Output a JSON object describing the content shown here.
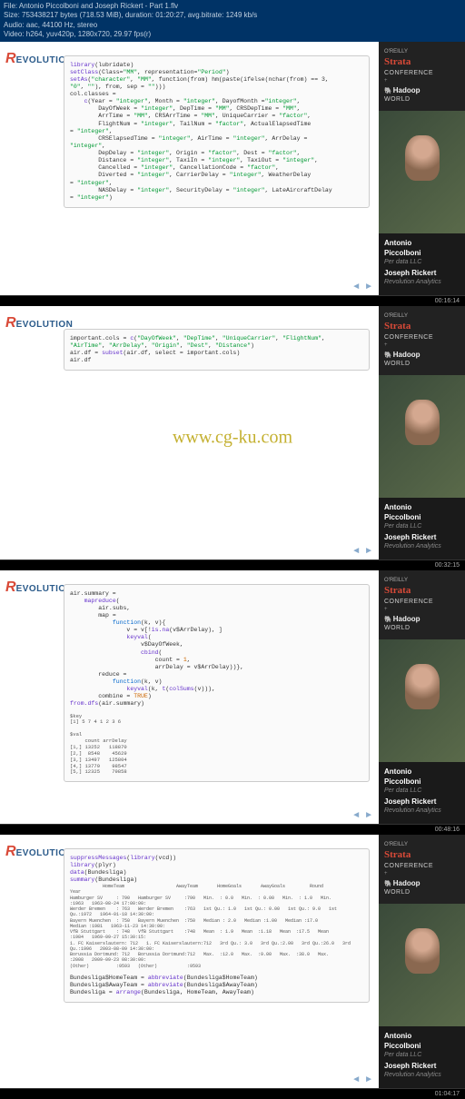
{
  "header": {
    "file": "File: Antonio Piccolboni and Joseph Rickert - Part 1.flv",
    "size": "Size: 753438217 bytes (718.53 MiB), duration: 01:20:27, avg.bitrate: 1249 kb/s",
    "audio": "Audio: aac, 44100 Hz, stereo",
    "video": "Video: h264, yuv420p, 1280x720, 29.97 fps(r)"
  },
  "watermark": "www.cg-ku.com",
  "conference": {
    "oreilly": "O'REILLY",
    "strata": "Strata",
    "conference": "CONFERENCE",
    "plus": "+",
    "hadoop": "Hadoop",
    "world": "WORLD"
  },
  "speakers": {
    "name1": "Antonio",
    "surname1": "Piccolboni",
    "org1": "Per data LLC",
    "name2": "Joseph Rickert",
    "org2": "Revolution Analytics"
  },
  "logo": {
    "r": "R",
    "rest": "EVOLUTION"
  },
  "nav": {
    "prev": "◄",
    "next": "►"
  },
  "timecodes": {
    "t1": "00:16:14",
    "t2": "00:32:15",
    "t3": "00:48:16",
    "t4": "01:04:17"
  },
  "code1_lines": [
    {
      "indent": 0,
      "parts": [
        [
          "fn",
          "library"
        ],
        [
          "",
          "(lubridate)"
        ]
      ]
    },
    {
      "indent": 0,
      "parts": [
        [
          "fn",
          "setClass"
        ],
        [
          "",
          "(Class="
        ],
        [
          "str",
          "\"MM\""
        ],
        [
          "",
          ", representation="
        ],
        [
          "str",
          "\"Period\""
        ],
        [
          "",
          ")"
        ]
      ]
    },
    {
      "indent": 0,
      "parts": [
        [
          "fn",
          "setAs"
        ],
        [
          "",
          "("
        ],
        [
          "str",
          "\"character\""
        ],
        [
          "",
          ", "
        ],
        [
          "str",
          "\"MM\""
        ],
        [
          "",
          ", function(from) hm(paste(ifelse(nchar(from) == 3,"
        ]
      ]
    },
    {
      "indent": 0,
      "parts": [
        [
          "str",
          "\"0\""
        ],
        [
          "",
          ", "
        ],
        [
          "str",
          "\"\""
        ],
        [
          "",
          "), from, sep = "
        ],
        [
          "str",
          "\"\""
        ],
        [
          "",
          ")))"
        ]
      ]
    },
    {
      "indent": 0,
      "parts": [
        [
          "",
          "col.classes ="
        ]
      ]
    },
    {
      "indent": 2,
      "parts": [
        [
          "fn",
          "c"
        ],
        [
          "",
          "(Year = "
        ],
        [
          "str",
          "\"integer\""
        ],
        [
          "",
          ", Month = "
        ],
        [
          "str",
          "\"integer\""
        ],
        [
          "",
          ", DayofMonth ="
        ],
        [
          "str",
          "\"integer\""
        ],
        [
          "",
          ","
        ]
      ]
    },
    {
      "indent": 4,
      "parts": [
        [
          "",
          "DayOfWeek = "
        ],
        [
          "str",
          "\"integer\""
        ],
        [
          "",
          ", DepTime = "
        ],
        [
          "str",
          "\"MM\""
        ],
        [
          "",
          ", CRSDepTime = "
        ],
        [
          "str",
          "\"MM\""
        ],
        [
          "",
          ","
        ]
      ]
    },
    {
      "indent": 4,
      "parts": [
        [
          "",
          "ArrTime = "
        ],
        [
          "str",
          "\"MM\""
        ],
        [
          "",
          ", CRSArrTime = "
        ],
        [
          "str",
          "\"MM\""
        ],
        [
          "",
          ", UniqueCarrier = "
        ],
        [
          "str",
          "\"factor\""
        ],
        [
          "",
          ","
        ]
      ]
    },
    {
      "indent": 4,
      "parts": [
        [
          "",
          "FlightNum = "
        ],
        [
          "str",
          "\"integer\""
        ],
        [
          "",
          ", TailNum = "
        ],
        [
          "str",
          "\"factor\""
        ],
        [
          "",
          ", ActualElapsedTime"
        ]
      ]
    },
    {
      "indent": 0,
      "parts": [
        [
          "",
          "= "
        ],
        [
          "str",
          "\"integer\""
        ],
        [
          "",
          ","
        ]
      ]
    },
    {
      "indent": 4,
      "parts": [
        [
          "",
          "CRSElapsedTime = "
        ],
        [
          "str",
          "\"integer\""
        ],
        [
          "",
          ", AirTime = "
        ],
        [
          "str",
          "\"integer\""
        ],
        [
          "",
          ", ArrDelay ="
        ]
      ]
    },
    {
      "indent": 0,
      "parts": [
        [
          "str",
          "\"integer\""
        ],
        [
          "",
          ","
        ]
      ]
    },
    {
      "indent": 4,
      "parts": [
        [
          "",
          "DepDelay = "
        ],
        [
          "str",
          "\"integer\""
        ],
        [
          "",
          ", Origin = "
        ],
        [
          "str",
          "\"factor\""
        ],
        [
          "",
          ", Dest = "
        ],
        [
          "str",
          "\"factor\""
        ],
        [
          "",
          ","
        ]
      ]
    },
    {
      "indent": 4,
      "parts": [
        [
          "",
          "Distance = "
        ],
        [
          "str",
          "\"integer\""
        ],
        [
          "",
          ", TaxiIn = "
        ],
        [
          "str",
          "\"integer\""
        ],
        [
          "",
          ", TaxiOut = "
        ],
        [
          "str",
          "\"integer\""
        ],
        [
          "",
          ","
        ]
      ]
    },
    {
      "indent": 4,
      "parts": [
        [
          "",
          "Cancelled = "
        ],
        [
          "str",
          "\"integer\""
        ],
        [
          "",
          ", CancellationCode = "
        ],
        [
          "str",
          "\"factor\""
        ],
        [
          "",
          ","
        ]
      ]
    },
    {
      "indent": 4,
      "parts": [
        [
          "",
          "Diverted = "
        ],
        [
          "str",
          "\"integer\""
        ],
        [
          "",
          ", CarrierDelay = "
        ],
        [
          "str",
          "\"integer\""
        ],
        [
          "",
          ", WeatherDelay"
        ]
      ]
    },
    {
      "indent": 0,
      "parts": [
        [
          "",
          "= "
        ],
        [
          "str",
          "\"integer\""
        ],
        [
          "",
          ","
        ]
      ]
    },
    {
      "indent": 4,
      "parts": [
        [
          "",
          "NASDelay = "
        ],
        [
          "str",
          "\"integer\""
        ],
        [
          "",
          ", SecurityDelay = "
        ],
        [
          "str",
          "\"integer\""
        ],
        [
          "",
          ", LateAircraftDelay"
        ]
      ]
    },
    {
      "indent": 0,
      "parts": [
        [
          "",
          "= "
        ],
        [
          "str",
          "\"integer\""
        ],
        [
          "",
          ")"
        ]
      ]
    }
  ],
  "code2_lines": [
    {
      "indent": 0,
      "parts": [
        [
          "",
          "important.cols = "
        ],
        [
          "fn",
          "c"
        ],
        [
          "",
          "("
        ],
        [
          "str",
          "\"DayOfWeek\""
        ],
        [
          "",
          ", "
        ],
        [
          "str",
          "\"DepTime\""
        ],
        [
          "",
          ", "
        ],
        [
          "str",
          "\"UniqueCarrier\""
        ],
        [
          "",
          ", "
        ],
        [
          "str",
          "\"FlightNum\""
        ],
        [
          "",
          ","
        ]
      ]
    },
    {
      "indent": 0,
      "parts": [
        [
          "str",
          "\"AirTime\""
        ],
        [
          "",
          ", "
        ],
        [
          "str",
          "\"ArrDelay\""
        ],
        [
          "",
          ", "
        ],
        [
          "str",
          "\"Origin\""
        ],
        [
          "",
          ", "
        ],
        [
          "str",
          "\"Dest\""
        ],
        [
          "",
          ", "
        ],
        [
          "str",
          "\"Distance\""
        ],
        [
          "",
          ")"
        ]
      ]
    },
    {
      "indent": 0,
      "parts": [
        [
          "",
          "air.df = "
        ],
        [
          "fn",
          "subset"
        ],
        [
          "",
          "(air.df, select = important.cols)"
        ]
      ]
    },
    {
      "indent": 0,
      "parts": [
        [
          "",
          "air.df"
        ]
      ]
    }
  ],
  "code3_lines": [
    {
      "indent": 0,
      "parts": [
        [
          "",
          "air.summary ="
        ]
      ]
    },
    {
      "indent": 2,
      "parts": [
        [
          "fn",
          "mapreduce"
        ],
        [
          "",
          "("
        ]
      ]
    },
    {
      "indent": 4,
      "parts": [
        [
          "",
          "air.subs,"
        ]
      ]
    },
    {
      "indent": 4,
      "parts": [
        [
          "",
          "map ="
        ]
      ]
    },
    {
      "indent": 6,
      "parts": [
        [
          "kw",
          "function"
        ],
        [
          "",
          "(k, v){"
        ]
      ]
    },
    {
      "indent": 8,
      "parts": [
        [
          "",
          "v = v[!"
        ],
        [
          "fn",
          "is.na"
        ],
        [
          "",
          "(v$ArrDelay), ]"
        ]
      ]
    },
    {
      "indent": 8,
      "parts": [
        [
          "fn",
          "keyval"
        ],
        [
          "",
          "("
        ]
      ]
    },
    {
      "indent": 10,
      "parts": [
        [
          "",
          "v$DayOfWeek,"
        ]
      ]
    },
    {
      "indent": 10,
      "parts": [
        [
          "fn",
          "cbind"
        ],
        [
          "",
          "("
        ]
      ]
    },
    {
      "indent": 12,
      "parts": [
        [
          "",
          "count = "
        ],
        [
          "val",
          "1"
        ],
        [
          "",
          ","
        ]
      ]
    },
    {
      "indent": 12,
      "parts": [
        [
          "",
          "arrDelay = v$ArrDelay))},"
        ]
      ]
    },
    {
      "indent": 4,
      "parts": [
        [
          "",
          "reduce ="
        ]
      ]
    },
    {
      "indent": 6,
      "parts": [
        [
          "kw",
          "function"
        ],
        [
          "",
          "(k, v)"
        ]
      ]
    },
    {
      "indent": 8,
      "parts": [
        [
          "fn",
          "keyval"
        ],
        [
          "",
          "(k, "
        ],
        [
          "fn",
          "t"
        ],
        [
          "",
          "("
        ],
        [
          "fn",
          "colSums"
        ],
        [
          "",
          "(v))),"
        ]
      ]
    },
    {
      "indent": 4,
      "parts": [
        [
          "",
          "combine = "
        ],
        [
          "val",
          "TRUE"
        ],
        [
          "",
          ")"
        ]
      ]
    },
    {
      "indent": 0,
      "parts": [
        [
          "fn",
          "from.dfs"
        ],
        [
          "",
          "(air.summary)"
        ]
      ]
    }
  ],
  "output3": "$key\n[1] 5 7 4 1 2 3 6\n\n$val\n     count arrDelay\n[1,] 13252   118870\n[2,]  8548    45629\n[3,] 13497   125804\n[4,] 13779    98547\n[5,] 12325    79858",
  "code4_lines": [
    {
      "indent": 0,
      "parts": [
        [
          "fn",
          "suppressMessages"
        ],
        [
          "",
          "("
        ],
        [
          "fn",
          "library"
        ],
        [
          "",
          "(vcd))"
        ]
      ]
    },
    {
      "indent": 0,
      "parts": [
        [
          "fn",
          "library"
        ],
        [
          "",
          "(plyr)"
        ]
      ]
    },
    {
      "indent": 0,
      "parts": [
        [
          "fn",
          "data"
        ],
        [
          "",
          "(Bundesliga)"
        ]
      ]
    },
    {
      "indent": 0,
      "parts": [
        [
          "fn",
          "summary"
        ],
        [
          "",
          "(Bundesliga)"
        ]
      ]
    }
  ],
  "output4": "            HomeTeam                   AwayTeam       HomeGoals       AwayGoals         Round\nYear\nHamburger SV     : 790   Hamburger SV     :790   Min.  : 0.0   Min.  : 0.00   Min.  : 1.0   Min.\n:1963   1963-08-24 17:00:00:\nWerder Bremen    : 763   Werder Bremen    :763   1st Qu.: 1.0   1st Qu.: 0.00   1st Qu.: 9.0   1st\nQu.:1972   1964-01-18 14:30:00:\nBayern Muenchen  : 750   Bayern Muenchen  :750   Median : 2.0   Median :1.00   Median :17.0\nMedian :1981   1963-11-23 14:30:00:\nVfB Stuttgart    : 748   VfB Stuttgart    :748   Mean  : 1.9   Mean  :1.18   Mean  :17.5   Mean\n:1984   1969-09-27 15:30:15:\n1. FC Kaiserslautern: 712   1. FC Kaiserslautern:712   3rd Qu.: 3.0   3rd Qu.:2.00   3rd Qu.:26.0   3rd\nQu.:1996   2003-08-09 14:30:00:\nBorussia Dortmund: 712   Borussia Dortmund:712   Max.  :12.0   Max.  :9.00   Max.  :38.0   Max.\n:2008   2009-09-23 08:30:00:\n(Other)          :9593   (Other)           :9593",
  "code4b_lines": [
    {
      "indent": 0,
      "parts": [
        [
          "",
          "Bundesliga$HomeTeam = "
        ],
        [
          "fn",
          "abbreviate"
        ],
        [
          "",
          "(Bundesliga$HomeTeam)"
        ]
      ]
    },
    {
      "indent": 0,
      "parts": [
        [
          "",
          "Bundesliga$AwayTeam = "
        ],
        [
          "fn",
          "abbreviate"
        ],
        [
          "",
          "(Bundesliga$AwayTeam)"
        ]
      ]
    },
    {
      "indent": 0,
      "parts": [
        [
          "",
          "Bundesliga = "
        ],
        [
          "fn",
          "arrange"
        ],
        [
          "",
          "(Bundesliga, HomeTeam, AwayTeam)"
        ]
      ]
    }
  ]
}
